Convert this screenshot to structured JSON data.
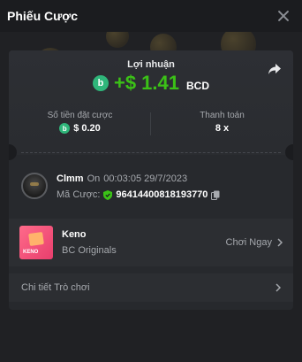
{
  "header": {
    "title": "Phiếu Cược"
  },
  "profit": {
    "label": "Lợi nhuận",
    "value": "+$ 1.41",
    "currency": "BCD",
    "coin_symbol": "b"
  },
  "stats": {
    "bet_amount_label": "Số tiền đặt cược",
    "bet_amount_value": "$ 0.20",
    "payout_label": "Thanh toán",
    "payout_value": "8 x"
  },
  "player": {
    "name": "Clmm",
    "on_label": "On",
    "time": "00:03:05 29/7/2023",
    "bet_id_label": "Mã Cược:",
    "bet_id": "96414400818193770"
  },
  "game": {
    "title": "Keno",
    "provider": "BC Originals",
    "play_label": "Chơi Ngay",
    "thumb_label": "KENO"
  },
  "details": {
    "label": "Chi tiết Trò chơi"
  },
  "colors": {
    "accent_green": "#3bc117",
    "coin_green": "#2fb67a"
  },
  "icons": [
    "close-icon",
    "share-icon",
    "coin-icon",
    "shield-icon",
    "copy-icon",
    "chevron-right-icon"
  ]
}
